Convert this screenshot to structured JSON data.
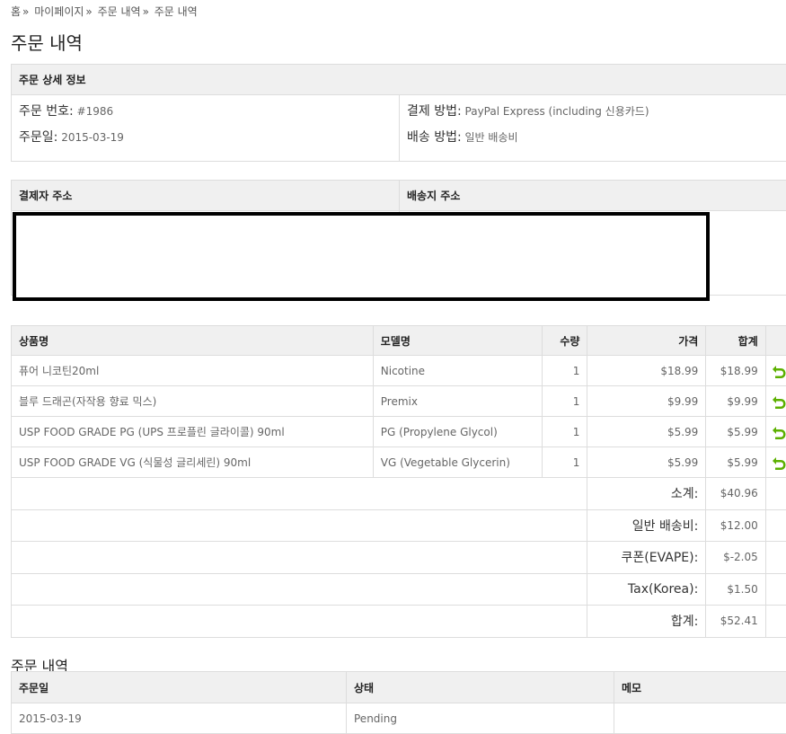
{
  "breadcrumb": {
    "items": [
      "홈",
      "마이페이지",
      "주문 내역",
      "주문 내역"
    ],
    "separator": "»"
  },
  "page_title": "주문 내역",
  "order_detail": {
    "header": "주문 상세 정보",
    "order_number_label": "주문 번호:",
    "order_number": "#1986",
    "order_date_label": "주문일:",
    "order_date": "2015-03-19",
    "payment_method_label": "결제 방법:",
    "payment_method": "PayPal Express (including 신용카드)",
    "shipping_method_label": "배송 방법:",
    "shipping_method": "일반 배송비"
  },
  "addresses": {
    "billing_header": "결제자 주소",
    "shipping_header": "배송지 주소"
  },
  "products": {
    "columns": {
      "name": "상품명",
      "model": "모델명",
      "qty": "수량",
      "price": "가격",
      "total": "합계"
    },
    "items": [
      {
        "name": "퓨어 니코틴20ml",
        "model": "Nicotine",
        "qty": "1",
        "price": "$18.99",
        "total": "$18.99"
      },
      {
        "name": "블루 드래곤(자작용 향료 믹스)",
        "model": "Premix",
        "qty": "1",
        "price": "$9.99",
        "total": "$9.99"
      },
      {
        "name": "USP FOOD GRADE PG (UPS 프로플린 글라이콜) 90ml",
        "model": "PG (Propylene Glycol)",
        "qty": "1",
        "price": "$5.99",
        "total": "$5.99"
      },
      {
        "name": "USP FOOD GRADE VG (식물성 글리세린) 90ml",
        "model": "VG (Vegetable Glycerin)",
        "qty": "1",
        "price": "$5.99",
        "total": "$5.99"
      }
    ],
    "return_icon": "return-arrow-icon",
    "return_icon_color": "#5cb000",
    "totals": [
      {
        "label": "소계:",
        "value": "$40.96"
      },
      {
        "label": "일반 배송비:",
        "value": "$12.00"
      },
      {
        "label": "쿠폰(EVAPE):",
        "value": "$-2.05"
      },
      {
        "label": "Tax(Korea):",
        "value": "$1.50"
      },
      {
        "label": "합계:",
        "value": "$52.41"
      }
    ]
  },
  "history": {
    "title": "주문 내역",
    "columns": {
      "date": "주문일",
      "status": "상태",
      "memo": "메모"
    },
    "rows": [
      {
        "date": "2015-03-19",
        "status": "Pending",
        "memo": ""
      }
    ]
  }
}
